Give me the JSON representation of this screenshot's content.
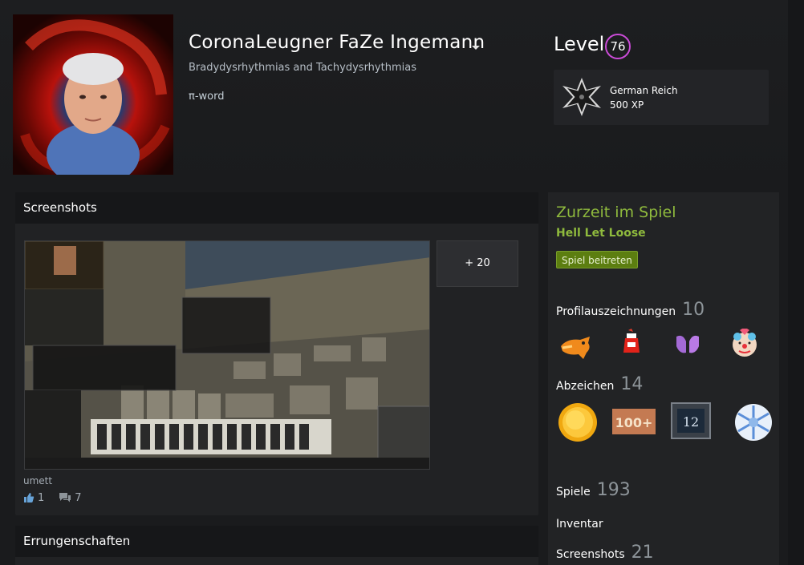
{
  "profile": {
    "persona_name": "CoronaLeugner FaZe Ingemann",
    "real_name": "Bradydysrhythmias and Tachydysrhythmias",
    "summary": "π-word",
    "level_label": "Level",
    "level": "76",
    "featured_badge": {
      "title": "German Reich",
      "xp": "500 XP",
      "icon": "iron-cross-icon"
    }
  },
  "screenshots": {
    "title": "Screenshots",
    "more_label": "+ 20",
    "caption": "umett",
    "likes": "1",
    "comments": "7"
  },
  "achievements": {
    "title": "Errungenschaften"
  },
  "sidebar": {
    "now_playing_label": "Zurzeit im Spiel",
    "now_playing_game": "Hell Let Loose",
    "join_label": "Spiel beitreten",
    "awards_label": "Profilauszeichnungen",
    "awards_count": "10",
    "awards_icons": [
      "dog-award-icon",
      "ketchup-award-icon",
      "hands-award-icon",
      "clown-award-icon"
    ],
    "badges_label": "Abzeichen",
    "badges_count": "14",
    "badge_icons": [
      "gold-coin-badge-icon",
      "100-plus-badge-icon",
      "years-12-badge-icon",
      "snowflake-badge-icon"
    ],
    "games_label": "Spiele",
    "games_count": "193",
    "inventory_label": "Inventar",
    "screenshots_label": "Screenshots",
    "screenshots_count": "21"
  },
  "colors": {
    "accent_green": "#8fba3d",
    "level_ring": "#c94bd6",
    "join_button": "#5c7e10"
  }
}
